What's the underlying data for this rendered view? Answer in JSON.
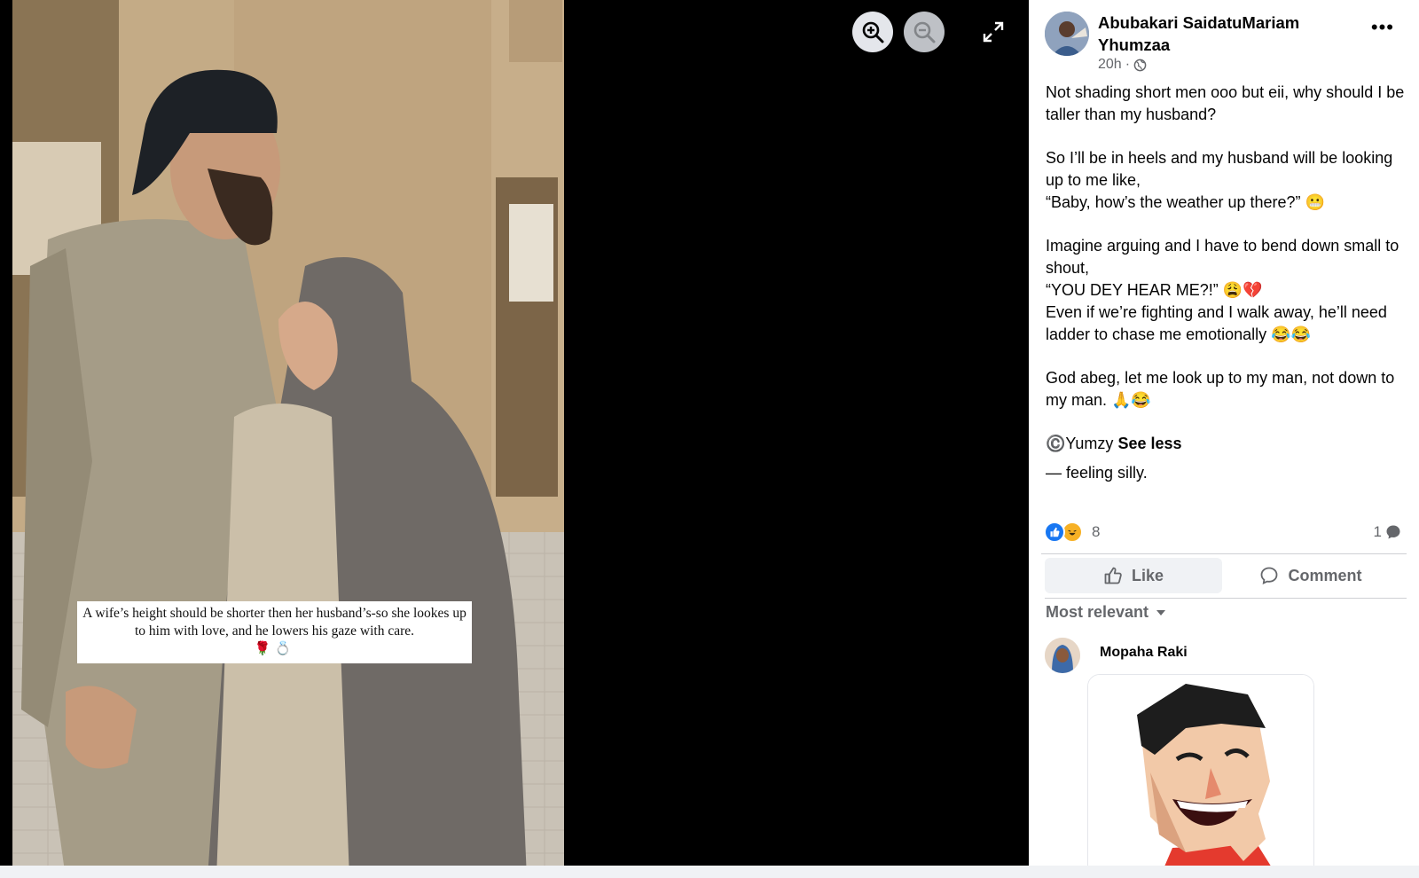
{
  "post": {
    "author": "Abubakari SaidatuMariam Yhumzaa",
    "time": "20h",
    "time_separator": "·",
    "more_label": "•••",
    "body": [
      "Not shading short men ooo but eii, why should I be taller than my husband?",
      "So I’ll be in heels and my husband will be looking up to me like,",
      "“Baby, how’s the weather up there?” 😬",
      "Imagine arguing and I have to bend down small to shout,",
      "“YOU DEY HEAR ME?!” 😩💔",
      "Even if we’re fighting and I walk away, he’ll need ladder to chase me emotionally 😂😂",
      "God abeg, let me look up to my man, not down to my man. 🙏😂",
      "©️Yumzy"
    ],
    "see_less": "See less",
    "feeling": "— feeling silly.",
    "reaction_count": "8",
    "comment_count": "1"
  },
  "image": {
    "caption": "A wife’s height should be shorter then her husband’s-so she lookes up to him with love, and he lowers his gaze with care.",
    "caption_emoji": "🌹💍"
  },
  "actions": {
    "like": "Like",
    "comment": "Comment"
  },
  "comments": {
    "sort_label": "Most relevant",
    "items": [
      {
        "name": "Mopaha Raki"
      }
    ]
  },
  "viewer": {
    "icons": [
      "zoom-in-icon",
      "zoom-out-icon",
      "fullscreen-icon"
    ]
  }
}
